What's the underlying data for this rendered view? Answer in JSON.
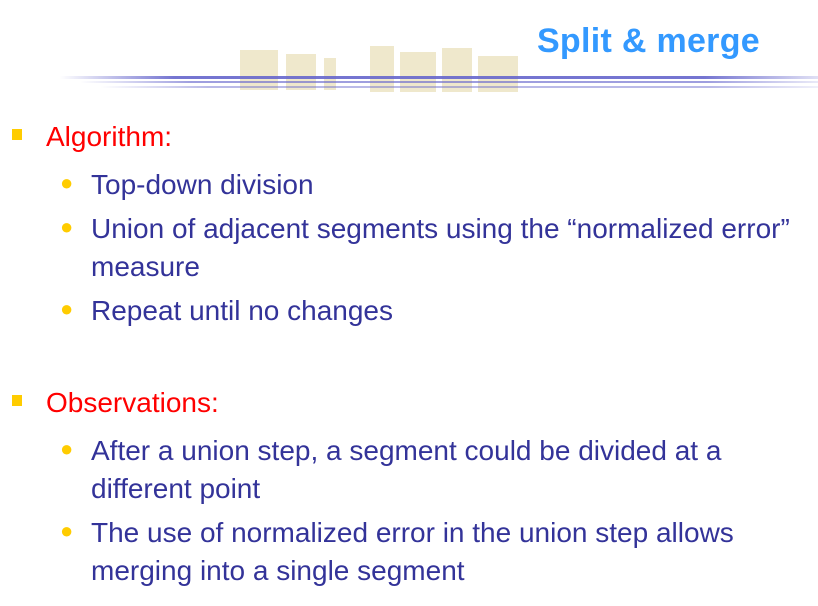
{
  "slide": {
    "title": "Split & merge",
    "sections": [
      {
        "heading": "Algorithm:",
        "items": [
          "Top-down division",
          "Union of adjacent segments using the “normalized error” measure",
          "Repeat until no changes"
        ]
      },
      {
        "heading": "Observations:",
        "items": [
          "After a union step, a segment could be divided at a different point",
          "The use of normalized error in the union step allows merging into a single segment"
        ]
      }
    ]
  },
  "colors": {
    "title": "#3399ff",
    "heading": "#ff0000",
    "body_text": "#333399",
    "bullet": "#ffcc00",
    "rule": "#6666cc"
  }
}
